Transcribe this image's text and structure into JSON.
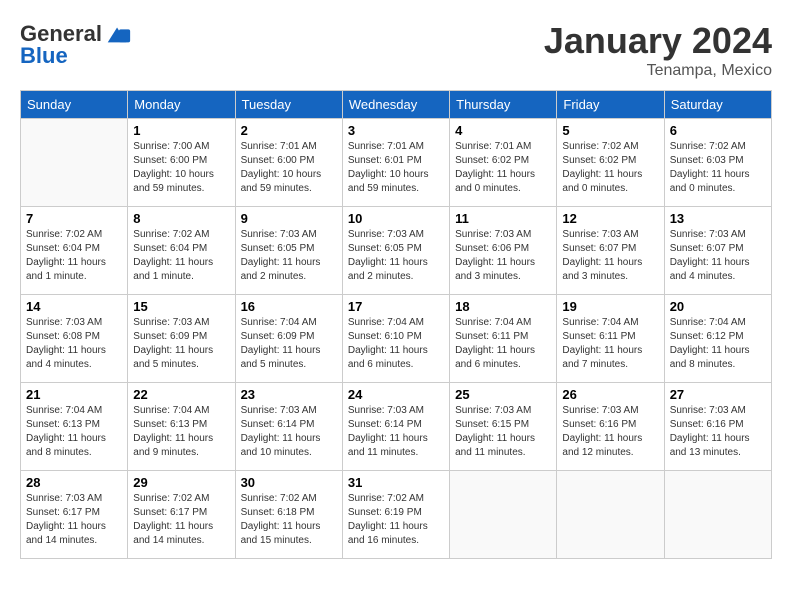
{
  "header": {
    "logo_general": "General",
    "logo_blue": "Blue",
    "month": "January 2024",
    "location": "Tenampa, Mexico"
  },
  "days_of_week": [
    "Sunday",
    "Monday",
    "Tuesday",
    "Wednesday",
    "Thursday",
    "Friday",
    "Saturday"
  ],
  "weeks": [
    [
      {
        "day": "",
        "info": ""
      },
      {
        "day": "1",
        "info": "Sunrise: 7:00 AM\nSunset: 6:00 PM\nDaylight: 10 hours\nand 59 minutes."
      },
      {
        "day": "2",
        "info": "Sunrise: 7:01 AM\nSunset: 6:00 PM\nDaylight: 10 hours\nand 59 minutes."
      },
      {
        "day": "3",
        "info": "Sunrise: 7:01 AM\nSunset: 6:01 PM\nDaylight: 10 hours\nand 59 minutes."
      },
      {
        "day": "4",
        "info": "Sunrise: 7:01 AM\nSunset: 6:02 PM\nDaylight: 11 hours\nand 0 minutes."
      },
      {
        "day": "5",
        "info": "Sunrise: 7:02 AM\nSunset: 6:02 PM\nDaylight: 11 hours\nand 0 minutes."
      },
      {
        "day": "6",
        "info": "Sunrise: 7:02 AM\nSunset: 6:03 PM\nDaylight: 11 hours\nand 0 minutes."
      }
    ],
    [
      {
        "day": "7",
        "info": "Sunrise: 7:02 AM\nSunset: 6:04 PM\nDaylight: 11 hours\nand 1 minute."
      },
      {
        "day": "8",
        "info": "Sunrise: 7:02 AM\nSunset: 6:04 PM\nDaylight: 11 hours\nand 1 minute."
      },
      {
        "day": "9",
        "info": "Sunrise: 7:03 AM\nSunset: 6:05 PM\nDaylight: 11 hours\nand 2 minutes."
      },
      {
        "day": "10",
        "info": "Sunrise: 7:03 AM\nSunset: 6:05 PM\nDaylight: 11 hours\nand 2 minutes."
      },
      {
        "day": "11",
        "info": "Sunrise: 7:03 AM\nSunset: 6:06 PM\nDaylight: 11 hours\nand 3 minutes."
      },
      {
        "day": "12",
        "info": "Sunrise: 7:03 AM\nSunset: 6:07 PM\nDaylight: 11 hours\nand 3 minutes."
      },
      {
        "day": "13",
        "info": "Sunrise: 7:03 AM\nSunset: 6:07 PM\nDaylight: 11 hours\nand 4 minutes."
      }
    ],
    [
      {
        "day": "14",
        "info": "Sunrise: 7:03 AM\nSunset: 6:08 PM\nDaylight: 11 hours\nand 4 minutes."
      },
      {
        "day": "15",
        "info": "Sunrise: 7:03 AM\nSunset: 6:09 PM\nDaylight: 11 hours\nand 5 minutes."
      },
      {
        "day": "16",
        "info": "Sunrise: 7:04 AM\nSunset: 6:09 PM\nDaylight: 11 hours\nand 5 minutes."
      },
      {
        "day": "17",
        "info": "Sunrise: 7:04 AM\nSunset: 6:10 PM\nDaylight: 11 hours\nand 6 minutes."
      },
      {
        "day": "18",
        "info": "Sunrise: 7:04 AM\nSunset: 6:11 PM\nDaylight: 11 hours\nand 6 minutes."
      },
      {
        "day": "19",
        "info": "Sunrise: 7:04 AM\nSunset: 6:11 PM\nDaylight: 11 hours\nand 7 minutes."
      },
      {
        "day": "20",
        "info": "Sunrise: 7:04 AM\nSunset: 6:12 PM\nDaylight: 11 hours\nand 8 minutes."
      }
    ],
    [
      {
        "day": "21",
        "info": "Sunrise: 7:04 AM\nSunset: 6:13 PM\nDaylight: 11 hours\nand 8 minutes."
      },
      {
        "day": "22",
        "info": "Sunrise: 7:04 AM\nSunset: 6:13 PM\nDaylight: 11 hours\nand 9 minutes."
      },
      {
        "day": "23",
        "info": "Sunrise: 7:03 AM\nSunset: 6:14 PM\nDaylight: 11 hours\nand 10 minutes."
      },
      {
        "day": "24",
        "info": "Sunrise: 7:03 AM\nSunset: 6:14 PM\nDaylight: 11 hours\nand 11 minutes."
      },
      {
        "day": "25",
        "info": "Sunrise: 7:03 AM\nSunset: 6:15 PM\nDaylight: 11 hours\nand 11 minutes."
      },
      {
        "day": "26",
        "info": "Sunrise: 7:03 AM\nSunset: 6:16 PM\nDaylight: 11 hours\nand 12 minutes."
      },
      {
        "day": "27",
        "info": "Sunrise: 7:03 AM\nSunset: 6:16 PM\nDaylight: 11 hours\nand 13 minutes."
      }
    ],
    [
      {
        "day": "28",
        "info": "Sunrise: 7:03 AM\nSunset: 6:17 PM\nDaylight: 11 hours\nand 14 minutes."
      },
      {
        "day": "29",
        "info": "Sunrise: 7:02 AM\nSunset: 6:17 PM\nDaylight: 11 hours\nand 14 minutes."
      },
      {
        "day": "30",
        "info": "Sunrise: 7:02 AM\nSunset: 6:18 PM\nDaylight: 11 hours\nand 15 minutes."
      },
      {
        "day": "31",
        "info": "Sunrise: 7:02 AM\nSunset: 6:19 PM\nDaylight: 11 hours\nand 16 minutes."
      },
      {
        "day": "",
        "info": ""
      },
      {
        "day": "",
        "info": ""
      },
      {
        "day": "",
        "info": ""
      }
    ]
  ]
}
